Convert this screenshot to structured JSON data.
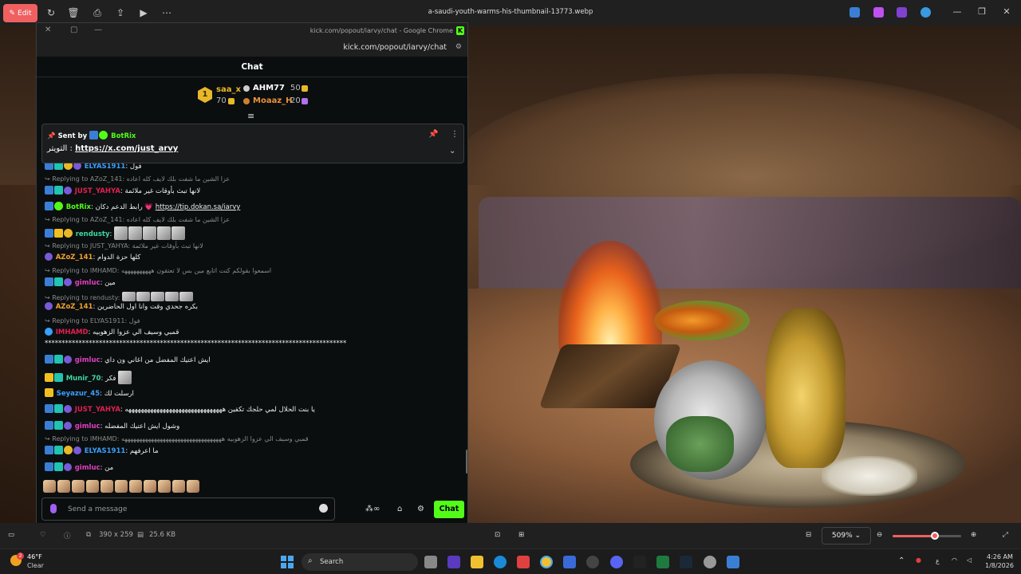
{
  "viewer": {
    "edit_label": "Edit",
    "file_title": "a-saudi-youth-warms-his-thumbnail-13773.webp",
    "zoom": "509%",
    "dimensions": "390 x 259",
    "file_size": "25.6 KB"
  },
  "chrome": {
    "window_title": "kick.com/popout/iarvy/chat - Google Chrome",
    "url": "kick.com/popout/iarvy/chat"
  },
  "chat": {
    "header": "Chat",
    "leaderboard": {
      "rank": "1",
      "first": {
        "name": "saa_x",
        "value": "70"
      },
      "second": {
        "name": "AHM77",
        "value": "50"
      },
      "third": {
        "name": "Moaaz_H",
        "value": "20"
      }
    },
    "pinned": {
      "sent_by": "Sent by",
      "sender": "BotRix",
      "prefix": "التويتر :",
      "link": "https://x.com/just_arvy"
    },
    "messages": [
      {
        "user": "ELYAS1911",
        "text": "فول"
      },
      {
        "reply": "Replying to AZoZ_141: عزا الشين ما شفت بلك لايف كله اعاده"
      },
      {
        "user": "JUST_YAHYA",
        "text": "لانها تبث بأوقات غير ملائمة"
      },
      {
        "user": "BotRix",
        "text": "رابط الدعم دكان 💗",
        "link": "https://tip.dokan.sa/iarvy"
      },
      {
        "reply": "Replying to AZoZ_141: عزا الشين ما شفت بلك لايف كله اعاده"
      },
      {
        "user": "rendusty",
        "text": ""
      },
      {
        "reply": "Replying to JUST_YAHYA: لانها تبث بأوقات غير ملائمة"
      },
      {
        "user": "AZoZ_141",
        "text": "كلها حزة الدوام"
      },
      {
        "reply": "Replying to IMHAMD: اسمعوا بقولكم كنت اتابع مين بس لا تعتقون ههههههههههه"
      },
      {
        "user": "gimluc",
        "text": "مين"
      },
      {
        "reply": "Replying to rendusty:"
      },
      {
        "user": "AZoZ_141",
        "text": "بكره جحدي وقت وانا اول الحاضرين"
      },
      {
        "reply": "Replying to ELYAS1911: فول"
      },
      {
        "user": "IMHAMD",
        "text": "قمبي وسيف الي عزوا الزهوبيه"
      },
      {
        "text": "*****************************************************************************************"
      },
      {
        "user": "gimluc",
        "text": "ايش اعتيك المفضل من اغاني ون داي"
      },
      {
        "user": "Munir_70",
        "text": "فكر"
      },
      {
        "user": "Seyazur_45",
        "text": "ارسلت لك"
      },
      {
        "user": "JUST_YAHYA",
        "text": "يا بنت الحلال لمي حلجك تكفين هههههههههههههههههههههههههههههههه"
      },
      {
        "user": "gimluc",
        "text": "وشول ايش اعتيك المفضله"
      },
      {
        "reply": "Replying to IMHAMD: قمبي وسيف الي عزوا الزهوبيه ههههههههههههههههههههههههههههههههههه"
      },
      {
        "user": "ELYAS1911",
        "text": "ما اعرفهم"
      },
      {
        "user": "gimluc",
        "text": "من"
      }
    ],
    "input_placeholder": "Send a message",
    "chat_button": "Chat"
  },
  "taskbar": {
    "temp": "46°F",
    "condition": "Clear",
    "weather_badge": "2",
    "search_label": "Search",
    "lang": "ع",
    "time": "4:26 AM",
    "date": "1/8/2026"
  },
  "colors": {
    "kick_green": "#53fc18",
    "edit_red": "#f06060",
    "gold": "#e8b82a"
  }
}
